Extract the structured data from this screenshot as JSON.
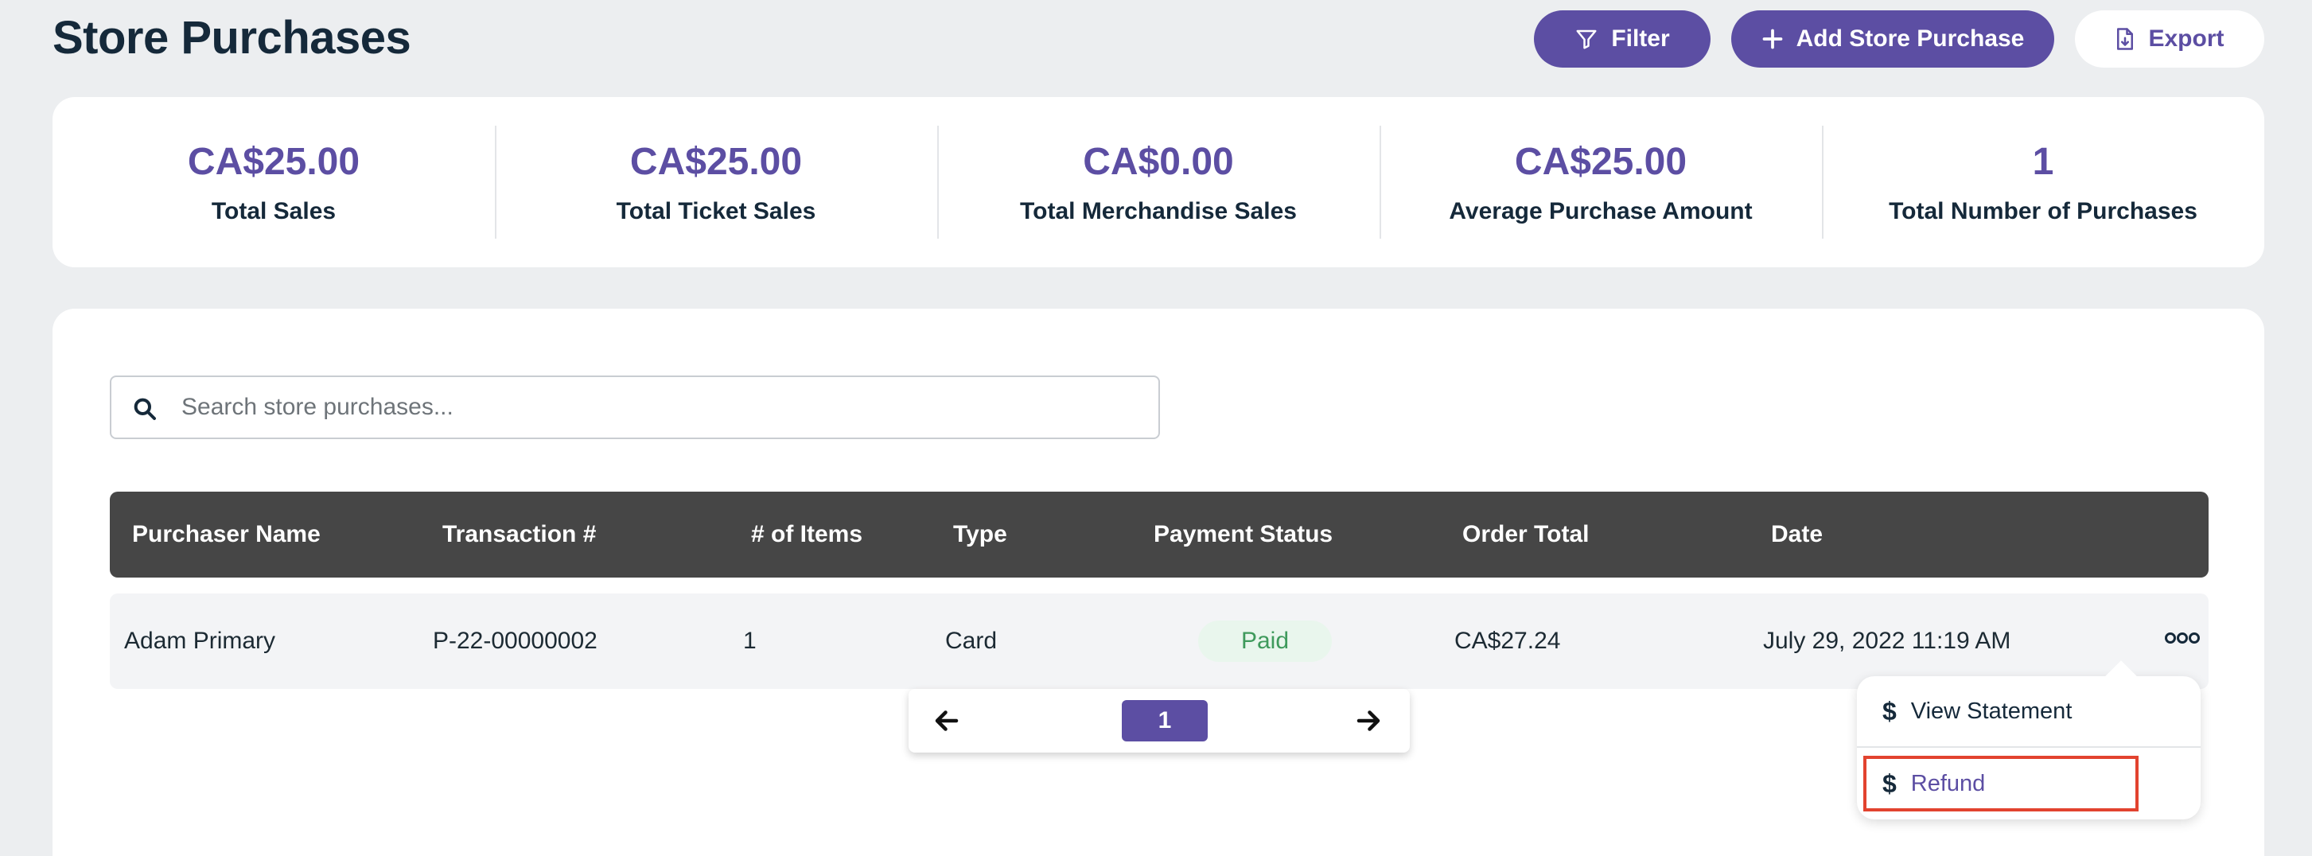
{
  "header": {
    "title": "Store Purchases",
    "filter_label": "Filter",
    "add_label": "Add Store Purchase",
    "export_label": "Export"
  },
  "stats": [
    {
      "value": "CA$25.00",
      "label": "Total Sales"
    },
    {
      "value": "CA$25.00",
      "label": "Total Ticket Sales"
    },
    {
      "value": "CA$0.00",
      "label": "Total Merchandise Sales"
    },
    {
      "value": "CA$25.00",
      "label": "Average Purchase Amount"
    },
    {
      "value": "1",
      "label": "Total Number of Purchases"
    }
  ],
  "search": {
    "placeholder": "Search store purchases...",
    "value": ""
  },
  "table": {
    "columns": [
      "Purchaser Name",
      "Transaction #",
      "# of Items",
      "Type",
      "Payment Status",
      "Order Total",
      "Date"
    ],
    "rows": [
      {
        "purchaser": "Adam Primary",
        "transaction": "P-22-00000002",
        "items": "1",
        "type": "Card",
        "status": "Paid",
        "total": "CA$27.24",
        "date": "July 29, 2022 11:19 AM"
      }
    ]
  },
  "pagination": {
    "current": "1"
  },
  "row_menu": {
    "items": [
      {
        "label": "View Statement",
        "icon": "dollar-icon"
      },
      {
        "label": "Refund",
        "icon": "dollar-icon"
      }
    ]
  },
  "colors": {
    "accent": "#5c4ea3",
    "header_dark": "#464646",
    "paid_text": "#3f9a5c",
    "paid_bg": "#e9f6ed",
    "highlight": "#e2432f"
  }
}
